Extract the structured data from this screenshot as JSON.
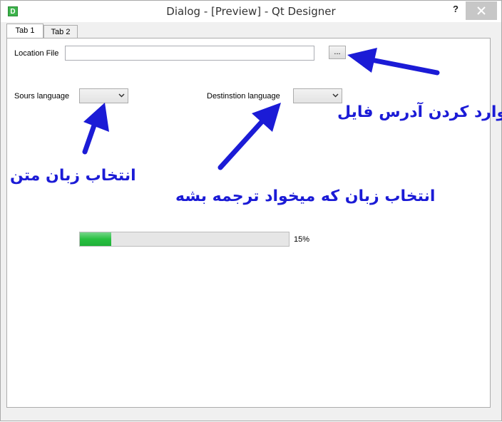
{
  "window": {
    "title": "Dialog - [Preview] - Qt Designer",
    "app_icon_letter": "D",
    "help_label": "?"
  },
  "tabs": [
    {
      "label": "Tab 1",
      "active": true
    },
    {
      "label": "Tab 2",
      "active": false
    }
  ],
  "form": {
    "location_label": "Location File",
    "location_value": "",
    "browse_label": "...",
    "source_language_label": "Sours language",
    "source_language_value": "",
    "destination_language_label": "Destinstion language",
    "destination_language_value": ""
  },
  "progress": {
    "value": 0.15,
    "text": "15%",
    "fill_color": "#28c040"
  },
  "annotations": {
    "enter_file_address": "وارد کردن آدرس فایل",
    "select_source_language": "انتخاب زبان متن",
    "select_target_language": "انتخاب زبان که میخواد ترجمه بشه",
    "color": "#1b1bd6"
  }
}
